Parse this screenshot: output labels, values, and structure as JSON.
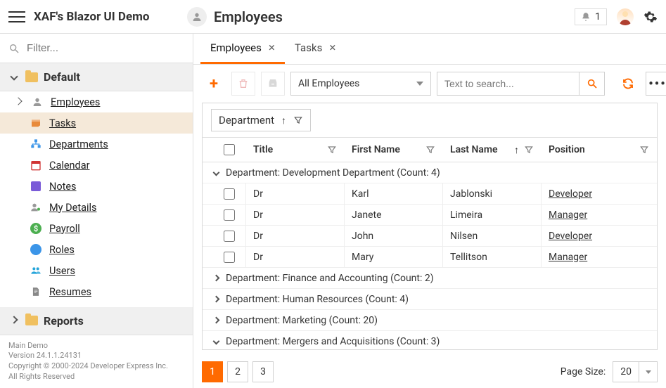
{
  "app_title": "XAF's Blazor UI Demo",
  "header": {
    "page_title": "Employees",
    "notification_count": "1"
  },
  "sidebar": {
    "filter_placeholder": "Filter...",
    "sections": [
      {
        "label": "Default",
        "expanded": true
      },
      {
        "label": "Reports",
        "expanded": false
      }
    ],
    "items": [
      {
        "label": "Employees",
        "icon": "person"
      },
      {
        "label": "Tasks",
        "icon": "inbox",
        "selected": true
      },
      {
        "label": "Departments",
        "icon": "org"
      },
      {
        "label": "Calendar",
        "icon": "calendar"
      },
      {
        "label": "Notes",
        "icon": "note"
      },
      {
        "label": "My Details",
        "icon": "mydetails"
      },
      {
        "label": "Payroll",
        "icon": "payroll"
      },
      {
        "label": "Roles",
        "icon": "roles"
      },
      {
        "label": "Users",
        "icon": "users"
      },
      {
        "label": "Resumes",
        "icon": "resume"
      }
    ],
    "footer": {
      "line1": "Main Demo",
      "line2": "Version 24.1.1.24131",
      "line3": "Copyright © 2000-2024 Developer Express Inc.",
      "line4": "All Rights Reserved"
    }
  },
  "tabs": [
    {
      "label": "Employees",
      "active": true
    },
    {
      "label": "Tasks",
      "active": false
    }
  ],
  "toolbar": {
    "view_selector": "All Employees",
    "search_placeholder": "Text to search..."
  },
  "grid": {
    "group_chip": "Department",
    "columns": {
      "title": "Title",
      "first_name": "First Name",
      "last_name": "Last Name",
      "position": "Position"
    },
    "groups": [
      {
        "label": "Department: Development Department (Count: 4)",
        "expanded": true,
        "rows": [
          {
            "title": "Dr",
            "first": "Karl",
            "last": "Jablonski",
            "position": "Developer"
          },
          {
            "title": "Dr",
            "first": "Janete",
            "last": "Limeira",
            "position": "Manager"
          },
          {
            "title": "Dr",
            "first": "John",
            "last": "Nilsen",
            "position": "Developer"
          },
          {
            "title": "Dr",
            "first": "Mary",
            "last": "Tellitson",
            "position": "Manager"
          }
        ]
      },
      {
        "label": "Department: Finance and Accounting (Count: 2)",
        "expanded": false,
        "rows": []
      },
      {
        "label": "Department: Human Resources (Count: 4)",
        "expanded": false,
        "rows": []
      },
      {
        "label": "Department: Marketing (Count: 20)",
        "expanded": false,
        "rows": []
      },
      {
        "label": "Department: Mergers and Acquisitions (Count: 3)",
        "expanded": true,
        "rows": []
      }
    ]
  },
  "pager": {
    "pages": [
      "1",
      "2",
      "3"
    ],
    "active": "1",
    "page_size_label": "Page Size:",
    "page_size_value": "20"
  },
  "colors": {
    "accent": "#ff6a00"
  }
}
